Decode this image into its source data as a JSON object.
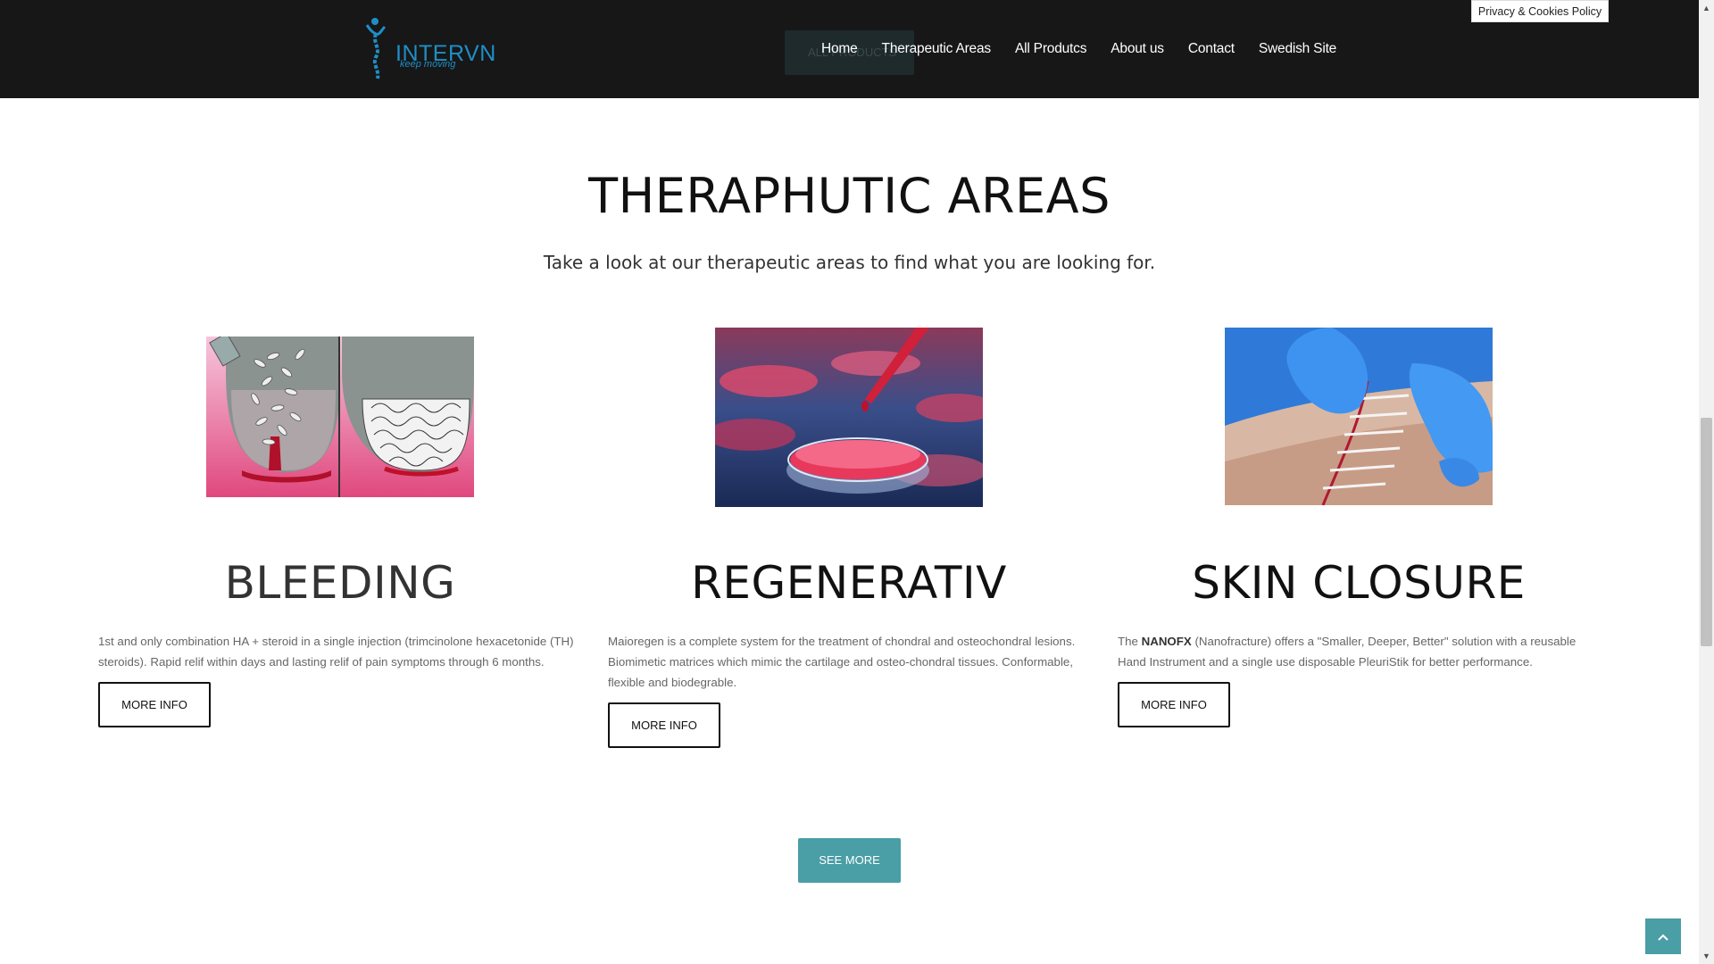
{
  "header": {
    "logo_text": "INTERVN",
    "logo_tagline": "keep moving",
    "ghost_button": "ALL PRODUCTS",
    "nav": [
      "Home",
      "Therapeutic Areas",
      "All Produtcs",
      "About us",
      "Contact",
      "Swedish Site"
    ],
    "privacy": "Privacy & Cookies Policy"
  },
  "section": {
    "title": "THERAPHUTIC AREAS",
    "subtitle": "Take a look at our therapeutic areas to find what you are looking for."
  },
  "cards": [
    {
      "title": "BLEEDING",
      "text": "1st and only combination HA + steroid in a single injection (trimcinolone hexacetonide (TH) steroids). Rapid relif within days and lasting relif of pain symptoms through 6 months.",
      "button": "MORE INFO",
      "title_color": "#333333"
    },
    {
      "title": "REGENERATIV",
      "text": "Maioregen is a complete system for the treatment of chondral and osteochondral lesions. Biomimetic matrices which mimic the cartilage and osteo-chondral tissues. Conformable, flexible and biodegrable.",
      "button": "MORE INFO",
      "title_color": "#111111"
    },
    {
      "title": "SKIN CLOSURE",
      "text_pre": "The ",
      "text_bold": "NANOFX",
      "text_post": " (Nanofracture) offers a \"Smaller, Deeper, Better\" solution with a reusable Hand Instrument and a single use disposable PleuriStik for better performance.",
      "button": "MORE INFO",
      "title_color": "#111111"
    }
  ],
  "see_more": "SEE MORE",
  "icons": {
    "to_top": "chevron-up-icon",
    "logo": "figure-spine-icon"
  },
  "colors": {
    "header_bg": "#171717",
    "accent": "#4a9ea6",
    "logo": "#1e8fc7"
  }
}
